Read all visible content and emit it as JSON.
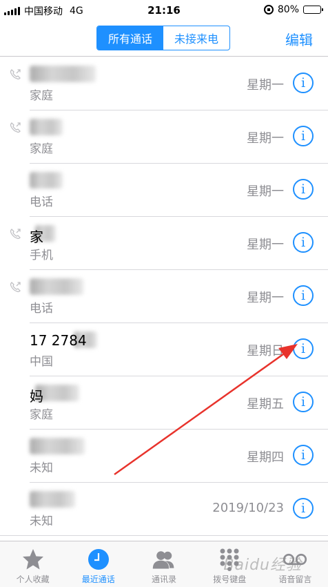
{
  "status_bar": {
    "carrier": "中国移动",
    "network": "4G",
    "time": "21:16",
    "battery": "80%",
    "battery_level": 0.8
  },
  "nav": {
    "segments": [
      {
        "label": "所有通话",
        "active": true
      },
      {
        "label": "未接来电",
        "active": false
      }
    ],
    "edit_label": "编辑"
  },
  "calls": [
    {
      "name": "",
      "type": "家庭",
      "date": "星期一",
      "outgoing": true
    },
    {
      "name": "",
      "type": "家庭",
      "date": "星期一",
      "outgoing": true
    },
    {
      "name": "",
      "type": "电话",
      "date": "星期一",
      "outgoing": false
    },
    {
      "name": "家",
      "type": "手机",
      "date": "星期一",
      "outgoing": true
    },
    {
      "name": "",
      "type": "电话",
      "date": "星期一",
      "outgoing": true
    },
    {
      "name": "17  2784",
      "type": "中国",
      "date": "星期日",
      "outgoing": false
    },
    {
      "name": "妈",
      "type": "家庭",
      "date": "星期五",
      "outgoing": false
    },
    {
      "name": "",
      "type": "未知",
      "date": "星期四",
      "outgoing": false
    },
    {
      "name": "",
      "type": "未知",
      "date": "2019/10/23",
      "outgoing": false
    }
  ],
  "tabs": [
    {
      "label": "个人收藏",
      "icon": "star-icon",
      "active": false
    },
    {
      "label": "最近通话",
      "icon": "clock-icon",
      "active": true
    },
    {
      "label": "通讯录",
      "icon": "contacts-icon",
      "active": false
    },
    {
      "label": "拨号键盘",
      "icon": "keypad-icon",
      "active": false
    },
    {
      "label": "语音留言",
      "icon": "voicemail-icon",
      "active": false
    }
  ],
  "watermark": "Baidu经验",
  "colors": {
    "accent": "#1e90ff",
    "secondary_text": "#8e8e93",
    "annotation_arrow": "#e8332c"
  }
}
